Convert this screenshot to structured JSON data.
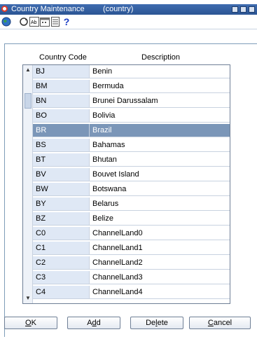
{
  "window": {
    "title": "Country Maintenance",
    "subtitle": "(country)"
  },
  "toolbar": {
    "icons": [
      "globe-icon",
      "refresh-icon",
      "abc-icon",
      "calendar-icon",
      "notepad-icon",
      "help-icon"
    ],
    "help_glyph": "?"
  },
  "grid": {
    "headers": {
      "code": "Country Code",
      "description": "Description"
    },
    "selected_index": 4,
    "rows": [
      {
        "code": "BJ",
        "description": "Benin"
      },
      {
        "code": "BM",
        "description": "Bermuda"
      },
      {
        "code": "BN",
        "description": "Brunei Darussalam"
      },
      {
        "code": "BO",
        "description": "Bolivia"
      },
      {
        "code": "BR",
        "description": "Brazil"
      },
      {
        "code": "BS",
        "description": "Bahamas"
      },
      {
        "code": "BT",
        "description": "Bhutan"
      },
      {
        "code": "BV",
        "description": "Bouvet Island"
      },
      {
        "code": "BW",
        "description": "Botswana"
      },
      {
        "code": "BY",
        "description": "Belarus"
      },
      {
        "code": "BZ",
        "description": "Belize"
      },
      {
        "code": "C0",
        "description": "ChannelLand0"
      },
      {
        "code": "C1",
        "description": "ChannelLand1"
      },
      {
        "code": "C2",
        "description": "ChannelLand2"
      },
      {
        "code": "C3",
        "description": "ChannelLand3"
      },
      {
        "code": "C4",
        "description": "ChannelLand4"
      }
    ]
  },
  "buttons": {
    "ok": {
      "mnemonic": "O",
      "rest": "K"
    },
    "add": {
      "pre": "A",
      "mnemonic": "d",
      "rest": "d"
    },
    "delete": {
      "pre": "De",
      "mnemonic": "l",
      "rest": "ete"
    },
    "cancel": {
      "mnemonic": "C",
      "rest": "ancel"
    }
  },
  "colors": {
    "titlebar": "#2b5593",
    "selected_row": "#7b96b8",
    "code_cell": "#dfe8f5"
  }
}
